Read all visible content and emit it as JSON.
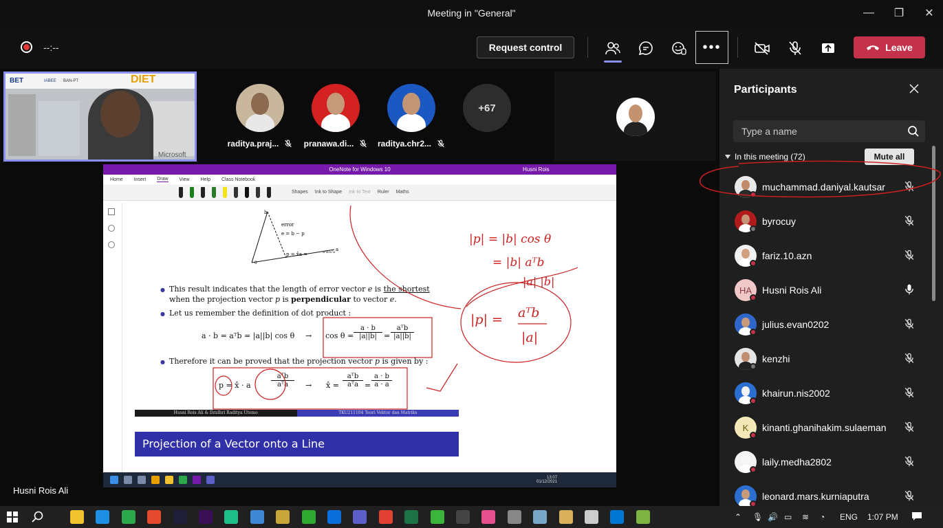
{
  "window": {
    "title": "Meeting in \"General\"",
    "minimize": "—",
    "maximize": "❐",
    "close": "✕"
  },
  "meeting_bar": {
    "timer": "--:--",
    "request_control": "Request control",
    "leave": "Leave",
    "accent": "#8b8ff0",
    "leave_color": "#c4314b"
  },
  "stage": {
    "speaker_name": "Husni Rois Ali",
    "tiles": [
      {
        "name": "raditya.praj...",
        "avatar_bg": "#c9b79d",
        "face": "#8b6a4f",
        "body": "#e8e8e8"
      },
      {
        "name": "pranawa.di...",
        "avatar_bg": "#d32020",
        "face": "#c59a7a",
        "body": "#ffffff"
      },
      {
        "name": "raditya.chr2...",
        "avatar_bg": "#1c58c2",
        "face": "#c39575",
        "body": "#ffffff"
      }
    ],
    "overflow_count": "+67",
    "self_video_text": [
      "BET",
      "IABEE",
      "BAN-PT",
      "DIET",
      "Microsoft"
    ]
  },
  "onenote": {
    "title": "OneNote for Windows 10",
    "user": "Husni Rois",
    "menu": [
      "Home",
      "Insert",
      "Draw",
      "View",
      "Help",
      "Class Notebook"
    ],
    "tools": [
      "Shapes",
      "Ink to Shape",
      "Ink to Text",
      "Ruler",
      "Maths"
    ],
    "slide": {
      "diagram_labels": {
        "b": "b",
        "error": "error",
        "e_eq": "e = b − p",
        "p_eq": "p = x̂a =",
        "frac": "aᵀb/aᵀa",
        "a": "a",
        "theta": "θ"
      },
      "bullet1_line1_a": "This result indicates that the length of error vector ",
      "bullet1_line1_e": "e",
      "bullet1_line1_b": " is ",
      "bullet1_line1_u": "the shortest",
      "bullet1_line2_a": "when the projection vector ",
      "bullet1_line2_p": "p",
      "bullet1_line2_b": " is ",
      "bullet1_line2_bold": "perpendicular",
      "bullet1_line2_c": " to vector ",
      "bullet1_line2_e": "e",
      "bullet1_line2_d": ".",
      "bullet2": "Let us remember the definition of dot product :",
      "eq1_left": "a · b = aᵀb = |a||b| cos θ",
      "arrow": "→",
      "eq1_cos": "cos θ =",
      "eq1_f1_num": "a · b",
      "eq1_f1_den": "|a||b|",
      "eq1_eq": "=",
      "eq1_f2_num": "aᵀb",
      "eq1_f2_den": "|a||b|",
      "bullet3_a": "Therefore it can be proved that the projection vector ",
      "bullet3_p": "p",
      "bullet3_b": " is given by :",
      "eq2_left": "p = x̂ · a",
      "eq2_mid_num": "aᵀb",
      "eq2_mid_den": "aᵀa",
      "eq2_xhat": "x̂ =",
      "eq2_f1_num": "aᵀb",
      "eq2_f1_den": "aᵀa",
      "eq2_f2_num": "a · b",
      "eq2_f2_den": "a · a",
      "footer_left": "Husni Rois Ali & Dzulhri Raditya Utomo",
      "footer_right": "TKU211104 Teori Vektor dan Matriks"
    },
    "next_slide_title": "Projection of a Vector onto a Line",
    "handwriting": [
      "|p| = |b| cos θ",
      "= |b| aᵀb",
      "|a| |b|",
      "|p| =",
      "aᵀb",
      "|a|"
    ],
    "clock_time": "13:07",
    "clock_date": "01/12/2021"
  },
  "participants_panel": {
    "title": "Participants",
    "search_placeholder": "Type a name",
    "section_label": "In this meeting (72)",
    "mute_all": "Mute all",
    "people": [
      {
        "name": "muchammad.daniyal.kautsar",
        "avatar": "photo",
        "bg": "#e9e9e9",
        "face": "#c08b6b",
        "body": "#2b2b2b",
        "mic": "muted",
        "dot": "red"
      },
      {
        "name": "byrocuy",
        "avatar": "photo",
        "bg": "#b11b1b",
        "face": "#c69476",
        "body": "#ffffff",
        "mic": "muted",
        "dot": "gray"
      },
      {
        "name": "fariz.10.azn",
        "avatar": "photo",
        "bg": "#f1f1f1",
        "face": "#d2a07f",
        "body": "#ffffff",
        "mic": "muted",
        "dot": "red"
      },
      {
        "name": "Husni Rois Ali",
        "avatar": "initials",
        "initials": "HA",
        "bg": "#f1c8c8",
        "fg": "#8a3b3b",
        "mic": "on",
        "dot": "red"
      },
      {
        "name": "julius.evan0202",
        "avatar": "photo",
        "bg": "#2e67c9",
        "face": "#c7987a",
        "body": "#ffffff",
        "mic": "muted",
        "dot": "red"
      },
      {
        "name": "kenzhi",
        "avatar": "photo",
        "bg": "#e5e5e5",
        "face": "#c18f6f",
        "body": "#222222",
        "mic": "muted",
        "dot": "gray"
      },
      {
        "name": "khairun.nis2002",
        "avatar": "photo",
        "bg": "#2b6fd1",
        "face": "#f2f2f2",
        "body": "#ffffff",
        "mic": "muted",
        "dot": "red"
      },
      {
        "name": "kinanti.ghanihakim.sulaeman",
        "avatar": "initials",
        "initials": "K",
        "bg": "#f5e8b8",
        "fg": "#6b5a10",
        "mic": "muted",
        "dot": "red"
      },
      {
        "name": "laily.medha2802",
        "avatar": "photo",
        "bg": "#f3f3f3",
        "face": "#f7f7f7",
        "body": "#ffffff",
        "mic": "muted",
        "dot": "red"
      },
      {
        "name": "leonard.mars.kurniaputra",
        "avatar": "photo",
        "bg": "#2b6fd1",
        "face": "#c99a79",
        "body": "#ffffff",
        "mic": "muted",
        "dot": "red"
      }
    ]
  },
  "taskbar": {
    "lang": "ENG",
    "time": "1:07 PM",
    "apps": [
      "#f2c12e",
      "#1f8fe3",
      "#2ba84a",
      "#e34a2e",
      "#1f1f3a",
      "#3a0f55",
      "#1fbf8a",
      "#3f88d6",
      "#c9a63b",
      "#2fa82f",
      "#0a6edb",
      "#5b5fc7",
      "#e34133",
      "#1d7345",
      "#3bb53b",
      "#444",
      "#e5508d",
      "#888",
      "#7aa6c8",
      "#d9b15a",
      "#ccc",
      "#0078d4",
      "#7cb342"
    ]
  }
}
